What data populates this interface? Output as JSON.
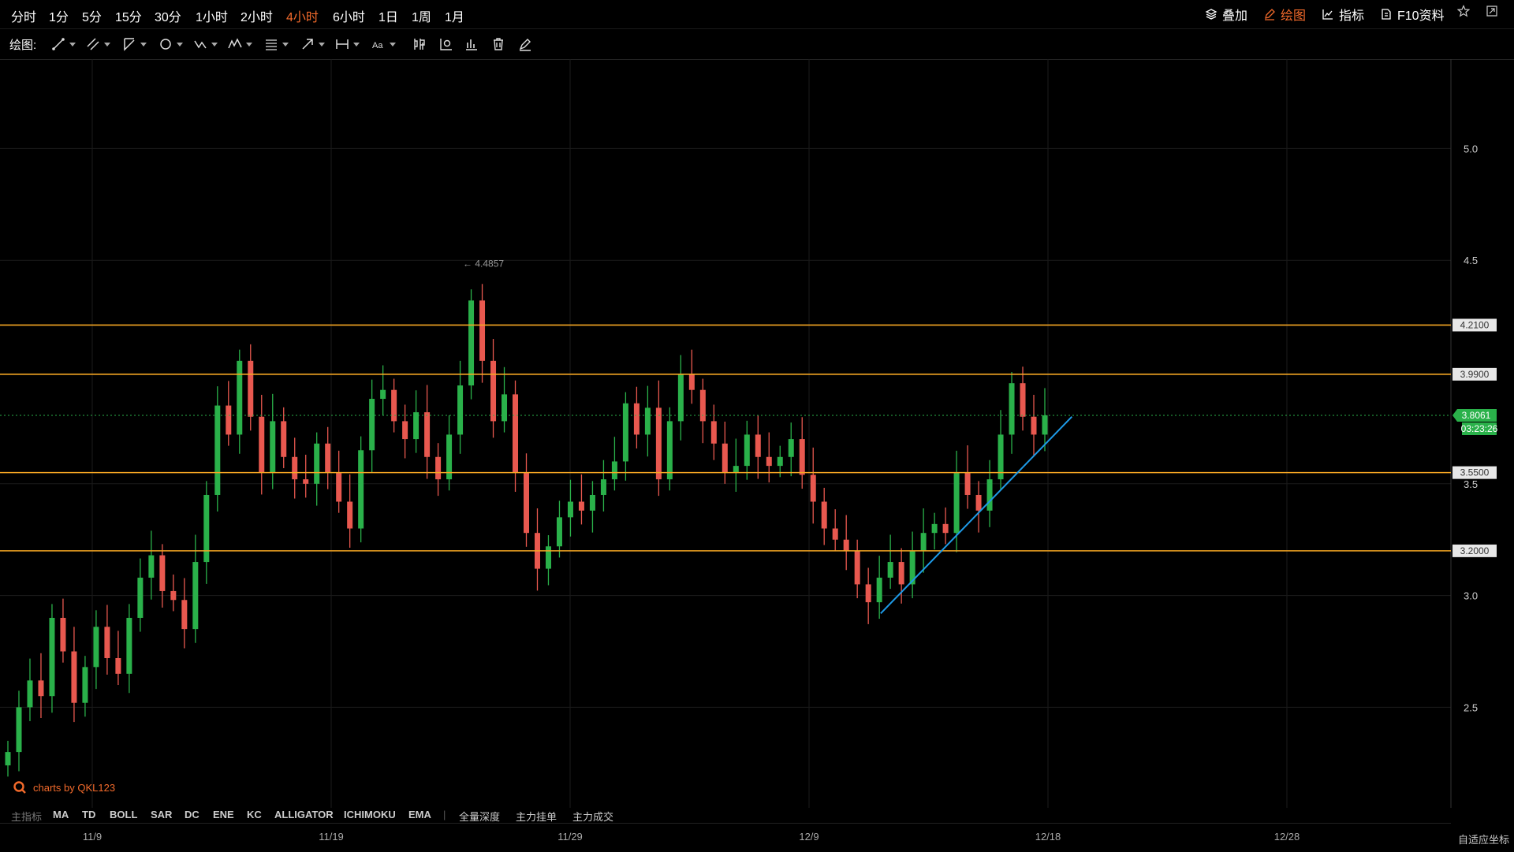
{
  "timeframes": [
    {
      "label": "分时",
      "active": false
    },
    {
      "label": "1分",
      "active": false
    },
    {
      "label": "5分",
      "active": false
    },
    {
      "label": "15分",
      "active": false
    },
    {
      "label": "30分",
      "active": false
    },
    {
      "label": "1小时",
      "active": false
    },
    {
      "label": "2小时",
      "active": false
    },
    {
      "label": "4小时",
      "active": true
    },
    {
      "label": "6小时",
      "active": false
    },
    {
      "label": "1日",
      "active": false
    },
    {
      "label": "1周",
      "active": false
    },
    {
      "label": "1月",
      "active": false
    }
  ],
  "right_menu": {
    "overlay": "叠加",
    "draw": "绘图",
    "indicator": "指标",
    "f10": "F10资料"
  },
  "draw_label": "绘图:",
  "indicators": {
    "main_label": "主指标",
    "items": [
      "MA",
      "TD",
      "BOLL",
      "SAR",
      "DC",
      "ENE",
      "KC",
      "ALLIGATOR",
      "ICHIMOKU",
      "EMA"
    ],
    "extra": [
      "全量深度",
      "主力挂单",
      "主力成交"
    ]
  },
  "brand_text": "charts by QKL123",
  "auto_axis_label": "自适应坐标",
  "colors": {
    "accent": "#f26a2b",
    "up": "#2ab14a",
    "down": "#e8584f",
    "hline": "#f5a623",
    "trendline": "#1e9be8",
    "price_tag": "#2ab14a"
  },
  "chart_data": {
    "type": "candlestick",
    "x_ticks": [
      "11/9",
      "11/19",
      "11/29",
      "12/9",
      "12/18",
      "12/28"
    ],
    "y_ticks": [
      "5.0",
      "4.5",
      "3.5",
      "3.0",
      "2.5"
    ],
    "ylim": [
      2.05,
      5.4
    ],
    "grid": true,
    "horizontal_levels": [
      "4.2100",
      "3.9900",
      "3.5500",
      "3.2000"
    ],
    "current_price": "3.8061",
    "countdown": "03:23:26",
    "max_annotation": "← 4.4857",
    "trendline": {
      "from": {
        "date": "12/12",
        "price": 2.92
      },
      "to": {
        "date": "12/20",
        "price": 3.8
      }
    },
    "series": [
      {
        "name": "close",
        "values": [
          2.3,
          2.5,
          2.62,
          2.55,
          2.9,
          2.75,
          2.52,
          2.68,
          2.86,
          2.72,
          2.65,
          2.9,
          3.08,
          3.18,
          3.02,
          2.98,
          2.85,
          3.15,
          3.45,
          3.85,
          3.72,
          4.05,
          3.8,
          3.55,
          3.78,
          3.62,
          3.52,
          3.5,
          3.68,
          3.55,
          3.42,
          3.3,
          3.65,
          3.88,
          3.92,
          3.78,
          3.7,
          3.82,
          3.62,
          3.52,
          3.72,
          3.94,
          4.32,
          4.05,
          3.78,
          3.9,
          3.55,
          3.28,
          3.12,
          3.22,
          3.35,
          3.42,
          3.38,
          3.45,
          3.52,
          3.6,
          3.86,
          3.72,
          3.84,
          3.52,
          3.78,
          3.99,
          3.92,
          3.78,
          3.68,
          3.55,
          3.58,
          3.72,
          3.62,
          3.58,
          3.62,
          3.7,
          3.54,
          3.42,
          3.3,
          3.25,
          3.2,
          3.05,
          2.97,
          3.08,
          3.15,
          3.05,
          3.2,
          3.28,
          3.32,
          3.28,
          3.55,
          3.45,
          3.38,
          3.52,
          3.72,
          3.95,
          3.8,
          3.72,
          3.8061
        ]
      }
    ]
  }
}
